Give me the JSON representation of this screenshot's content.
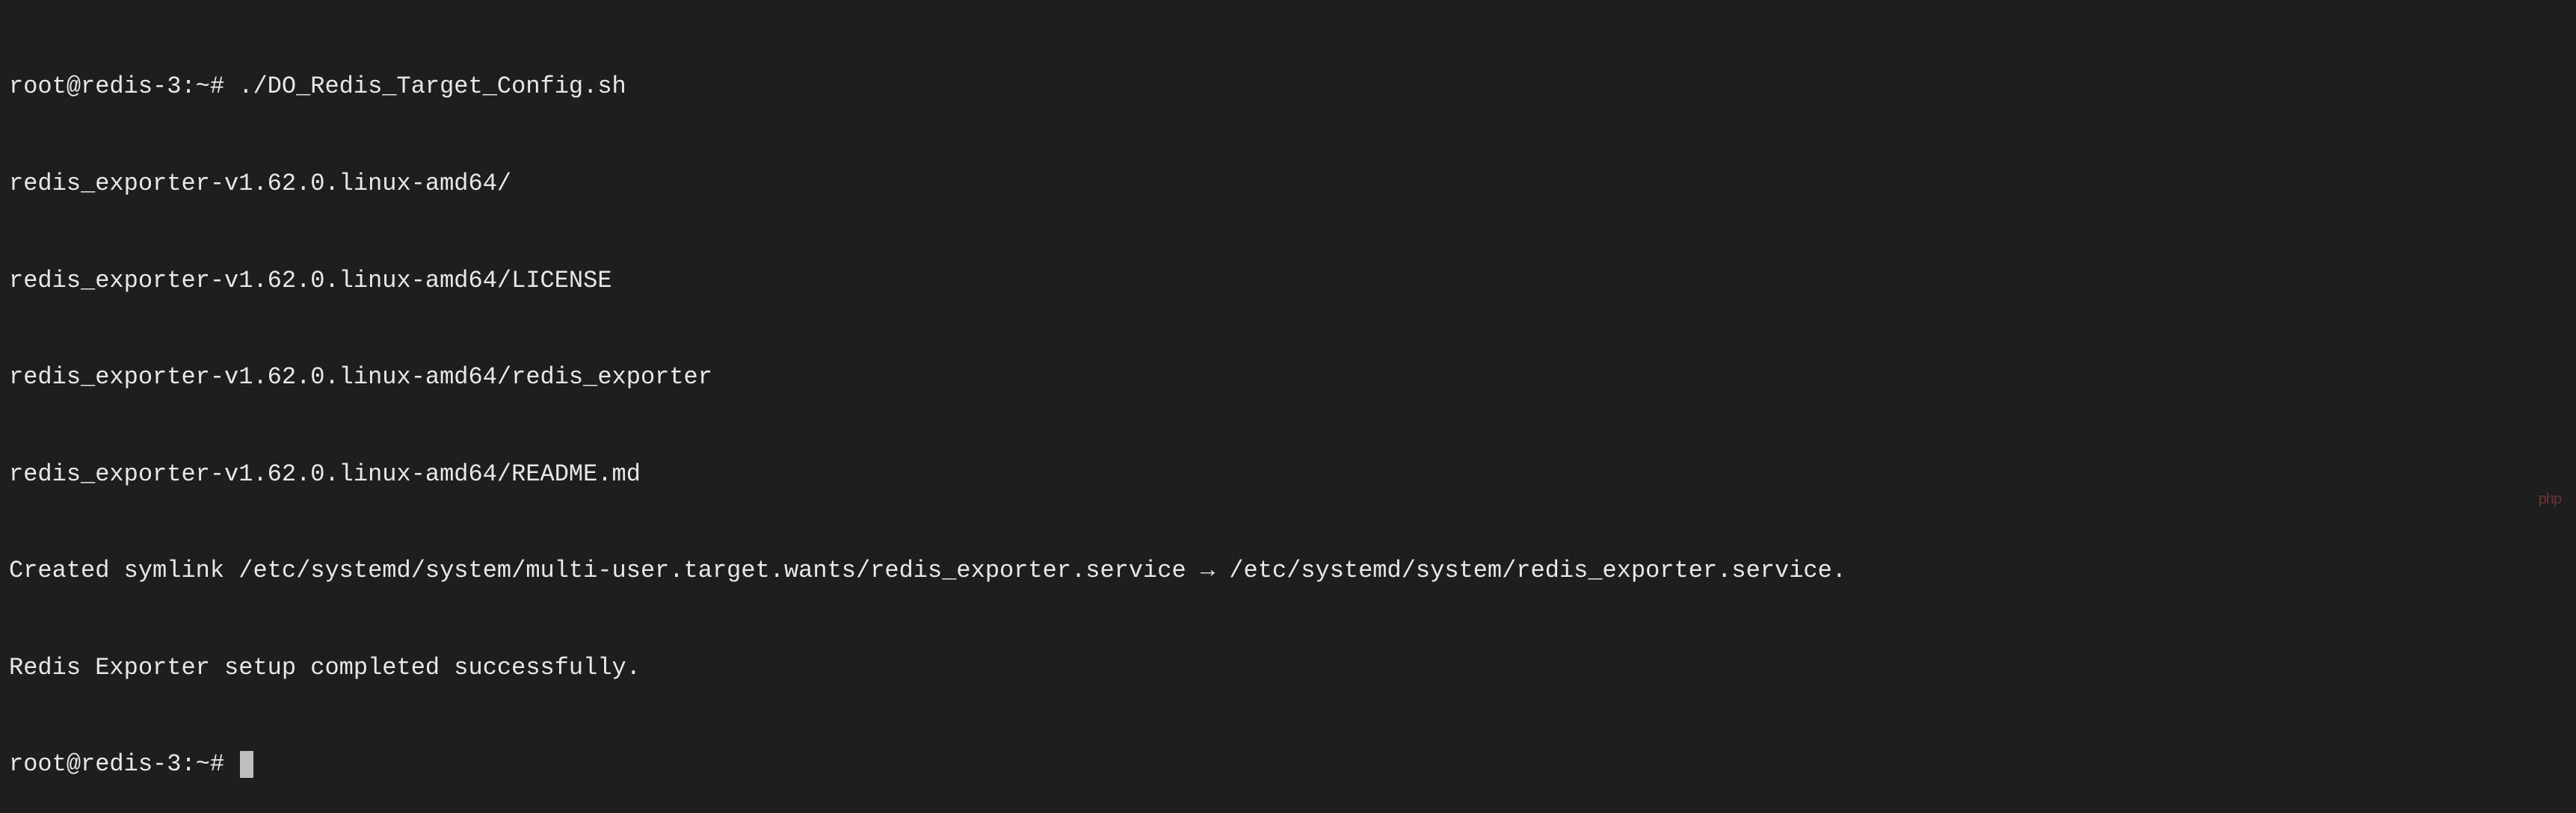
{
  "terminal": {
    "prompt1": "root@redis-3:~#",
    "command1": "./DO_Redis_Target_Config.sh",
    "output": {
      "line1": "redis_exporter-v1.62.0.linux-amd64/",
      "line2": "redis_exporter-v1.62.0.linux-amd64/LICENSE",
      "line3": "redis_exporter-v1.62.0.linux-amd64/redis_exporter",
      "line4": "redis_exporter-v1.62.0.linux-amd64/README.md",
      "line5": "Created symlink /etc/systemd/system/multi-user.target.wants/redis_exporter.service → /etc/systemd/system/redis_exporter.service.",
      "line6": "Redis Exporter setup completed successfully."
    },
    "prompt2": "root@redis-3:~#"
  },
  "watermark": "php"
}
